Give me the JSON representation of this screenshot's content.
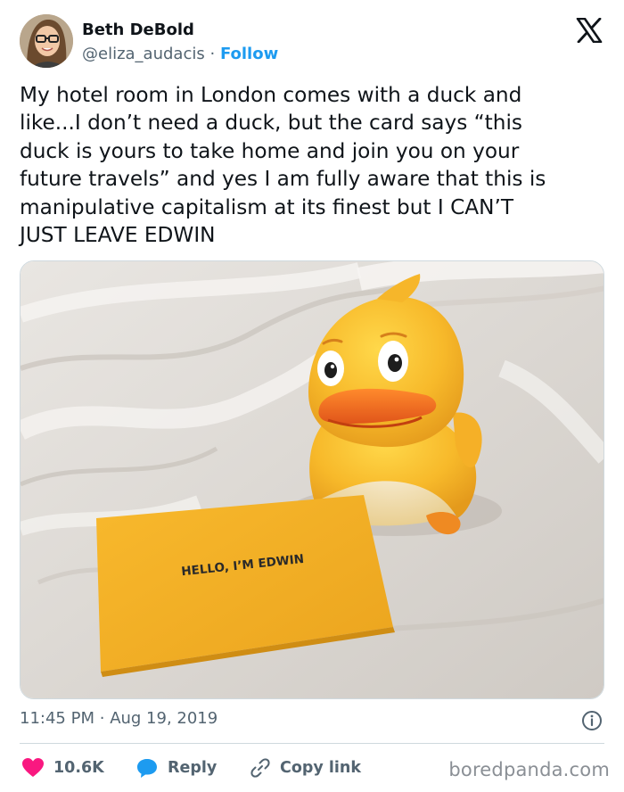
{
  "author": {
    "name": "Beth DeBold",
    "handle": "@eliza_audacis",
    "separator": "·",
    "follow_label": "Follow"
  },
  "platform_icon": "x-logo-icon",
  "tweet": {
    "text": "My hotel room in London comes with a duck and\nlike...I don’t need a duck, but the card says “this\nduck is yours to take home and join you on your\nfuture travels” and yes I am fully aware that this is\nmanipulative capitalism at its finest but I CAN’T\nJUST LEAVE EDWIN",
    "image_card_text": "HELLO, I’M EDWIN",
    "time": "11:45 PM",
    "date_separator": "·",
    "date": "Aug 19, 2019"
  },
  "actions": {
    "likes": "10.6K",
    "reply_label": "Reply",
    "copy_link_label": "Copy link"
  },
  "watermark": "boredpanda.com",
  "colors": {
    "accent": "#1d9bf0",
    "like": "#f91880",
    "text": "#0f1419",
    "secondary": "#536471"
  }
}
